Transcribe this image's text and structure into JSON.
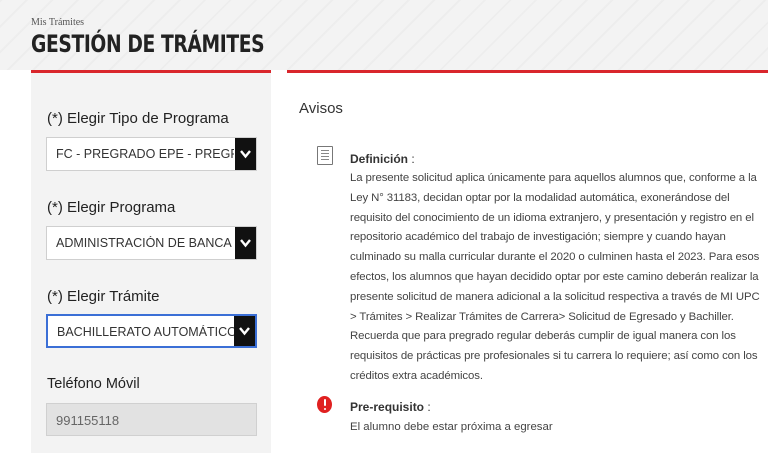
{
  "header": {
    "breadcrumb": "Mis Trámites",
    "title": "GESTIÓN DE TRÁMITES"
  },
  "form": {
    "tipo_programa_label": "(*) Elegir Tipo de Programa",
    "tipo_programa_value": "FC - PREGRADO EPE - PREGRADO",
    "programa_label": "(*) Elegir Programa",
    "programa_value": "ADMINISTRACIÓN DE BANCA Y",
    "tramite_label": "(*) Elegir Trámite",
    "tramite_value": "BACHILLERATO AUTOMÁTICO - LEY",
    "telefono_label": "Teléfono Móvil",
    "telefono_value": "991155118"
  },
  "avisos": {
    "heading": "Avisos",
    "definicion_title": "Definición",
    "definicion_suffix": " :",
    "definicion_text": "La presente solicitud aplica únicamente para aquellos alumnos que, conforme a la Ley N° 31183, decidan optar por la modalidad automática, exonerándose del requisito del conocimiento de un idioma extranjero, y presentación y registro en el repositorio académico del trabajo de investigación; siempre y cuando hayan culminado su malla curricular durante el 2020 o culminen hasta el 2023. Para esos efectos, los alumnos que hayan decidido optar por este camino deberán realizar la presente solicitud de manera adicional a la solicitud respectiva a través de MI UPC > Trámites > Realizar Trámites de Carrera> Solicitud de Egresado y Bachiller. Recuerda que para pregrado regular deberás cumplir de igual manera con los requisitos de prácticas pre profesionales si tu carrera lo requiere; así como con los créditos extra académicos.",
    "prerequisito_title": "Pre-requisito",
    "prerequisito_suffix": " :",
    "prerequisito_text": "El alumno debe estar próxima a egresar"
  },
  "icons": {
    "definition": "document-icon",
    "prerequisite": "alert-icon",
    "select_arrow": "chevron-down-icon"
  },
  "colors": {
    "accent": "#d9262c",
    "focus": "#3b6fd6",
    "arrow_bg": "#111111"
  }
}
